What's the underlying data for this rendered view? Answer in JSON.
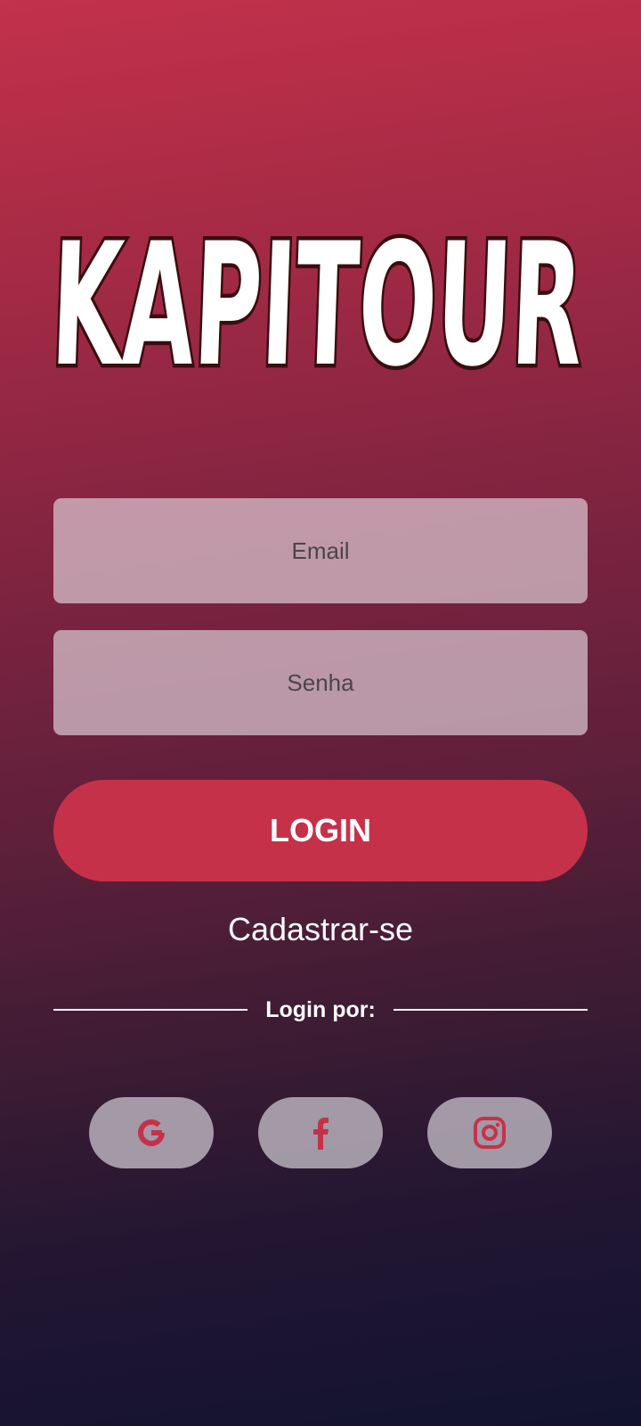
{
  "logo": {
    "text": "KAPITOUR"
  },
  "form": {
    "email_placeholder": "Email",
    "password_placeholder": "Senha",
    "login_label": "LOGIN",
    "register_label": "Cadastrar-se"
  },
  "social": {
    "divider_label": "Login por:",
    "items": [
      {
        "icon": "google-icon"
      },
      {
        "icon": "facebook-icon"
      },
      {
        "icon": "instagram-icon"
      }
    ]
  },
  "colors": {
    "accent": "#c6314a",
    "gradient_top": "#c3314b",
    "gradient_bottom": "#121330",
    "icon_color": "#c6314a"
  }
}
